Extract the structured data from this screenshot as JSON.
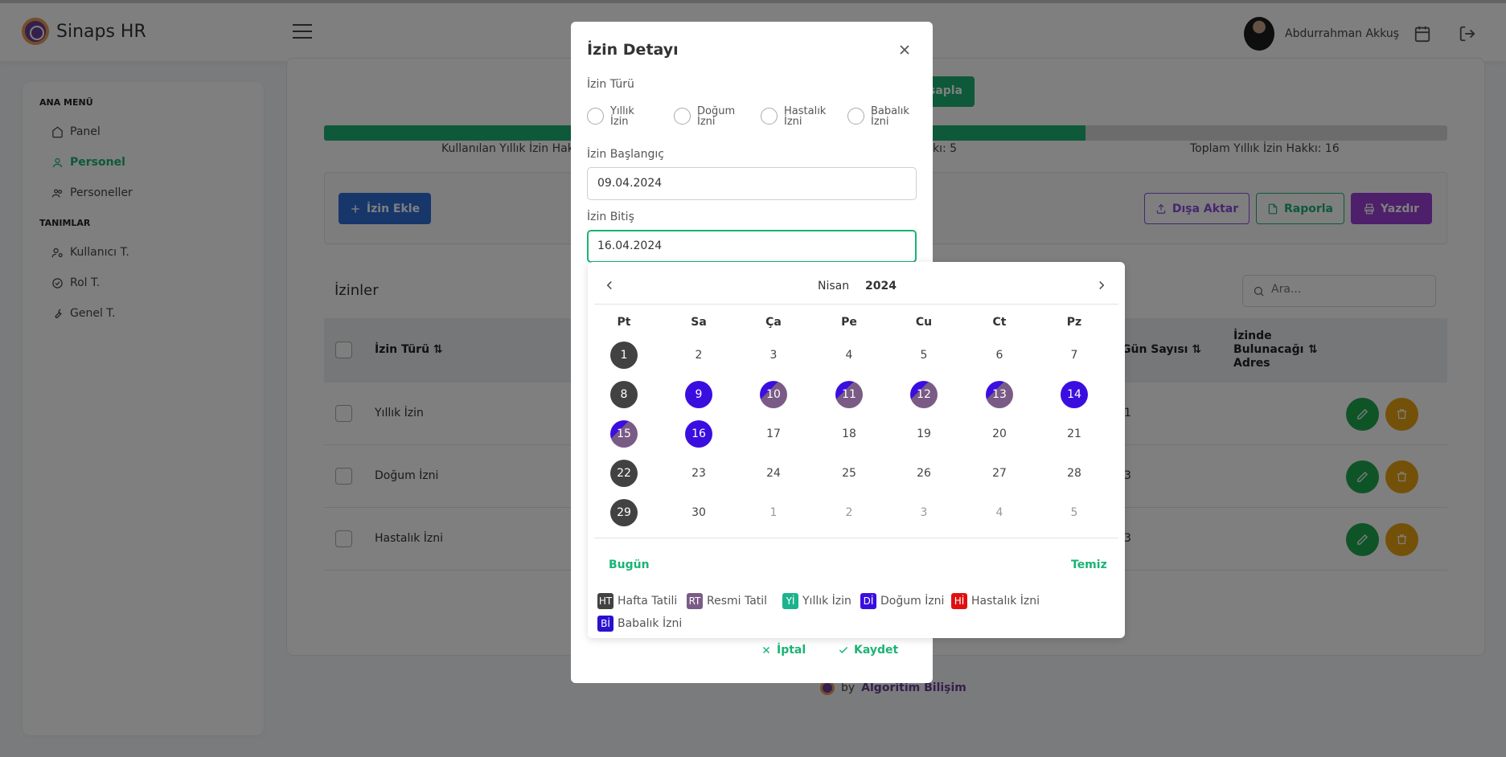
{
  "app": {
    "title": "Sinaps HR"
  },
  "user": {
    "name": "Abdurrahman Akkuş"
  },
  "sidebar": {
    "sections": [
      {
        "title": "ANA MENÜ"
      },
      {
        "title": "TANIMLAR"
      }
    ],
    "items": [
      {
        "label": "Panel",
        "icon": "home-icon"
      },
      {
        "label": "Personel",
        "icon": "user-icon",
        "active": true
      },
      {
        "label": "Personeller",
        "icon": "users-icon"
      },
      {
        "label": "Kullanıcı T.",
        "icon": "user-cog-icon"
      },
      {
        "label": "Rol T.",
        "icon": "check-circle-icon"
      },
      {
        "label": "Genel T.",
        "icon": "wrench-icon"
      }
    ]
  },
  "main": {
    "calc_button": "sapla",
    "progress": {
      "used_label": "Kullanılan Yıllık İzin Hakkı",
      "remaining_label": "kı: 5",
      "total_label": "Toplam Yıllık İzin Hakkı: 16",
      "fraction": 0.678
    },
    "toolbar": {
      "add": "İzin Ekle",
      "export": "Dışa Aktar",
      "report": "Raporla",
      "print": "Yazdır"
    },
    "list": {
      "title": "İzinler",
      "search_placeholder": "Ara...",
      "columns": {
        "type": "İzin Türü",
        "days": "Gün Sayısı",
        "address": "İzinde Bulunacağı Adres"
      },
      "rows": [
        {
          "type": "Yıllık İzin",
          "days": "1"
        },
        {
          "type": "Doğum İzni",
          "days": "3"
        },
        {
          "type": "Hastalık İzni",
          "days": "3"
        }
      ]
    }
  },
  "footer": {
    "by": "by",
    "company": "Algoritim Bilişim"
  },
  "modal": {
    "title": "İzin Detayı",
    "type_label": "İzin Türü",
    "types": [
      "Yıllık İzin",
      "Doğum İzni",
      "Hastalık İzni",
      "Babalık İzni"
    ],
    "start_label": "İzin Başlangıç",
    "start_value": "09.04.2024",
    "end_label": "İzin Bitiş",
    "end_value": "16.04.2024",
    "cancel": "İptal",
    "save": "Kaydet"
  },
  "datepicker": {
    "month": "Nisan",
    "year": "2024",
    "weekdays": [
      "Pt",
      "Sa",
      "Ça",
      "Pe",
      "Cu",
      "Ct",
      "Pz"
    ],
    "weeks": [
      [
        "1",
        "2",
        "3",
        "4",
        "5",
        "6",
        "7"
      ],
      [
        "8",
        "9",
        "10",
        "11",
        "12",
        "13",
        "14"
      ],
      [
        "15",
        "16",
        "17",
        "18",
        "19",
        "20",
        "21"
      ],
      [
        "22",
        "23",
        "24",
        "25",
        "26",
        "27",
        "28"
      ],
      [
        "29",
        "30",
        "1",
        "2",
        "3",
        "4",
        "5"
      ]
    ],
    "today": "Bugün",
    "clear": "Temiz",
    "legend": [
      {
        "abbr": "HT",
        "label": "Hafta Tatili",
        "color": "#424242"
      },
      {
        "abbr": "RT",
        "label": "Resmi Tatil",
        "color": "#7a5b86"
      },
      {
        "abbr": "Yİ",
        "label": "Yıllık İzin",
        "color": "#1bb38e"
      },
      {
        "abbr": "Dİ",
        "label": "Doğum İzni",
        "color": "#3b0ee0"
      },
      {
        "abbr": "Hİ",
        "label": "Hastalık İzni",
        "color": "#e01010"
      },
      {
        "abbr": "Bİ",
        "label": "Babalık İzni",
        "color": "#2a10d0"
      }
    ]
  },
  "colors": {
    "accent": "#1bb374",
    "primary": "#2f6fd6",
    "purple": "#9c3fd6"
  }
}
